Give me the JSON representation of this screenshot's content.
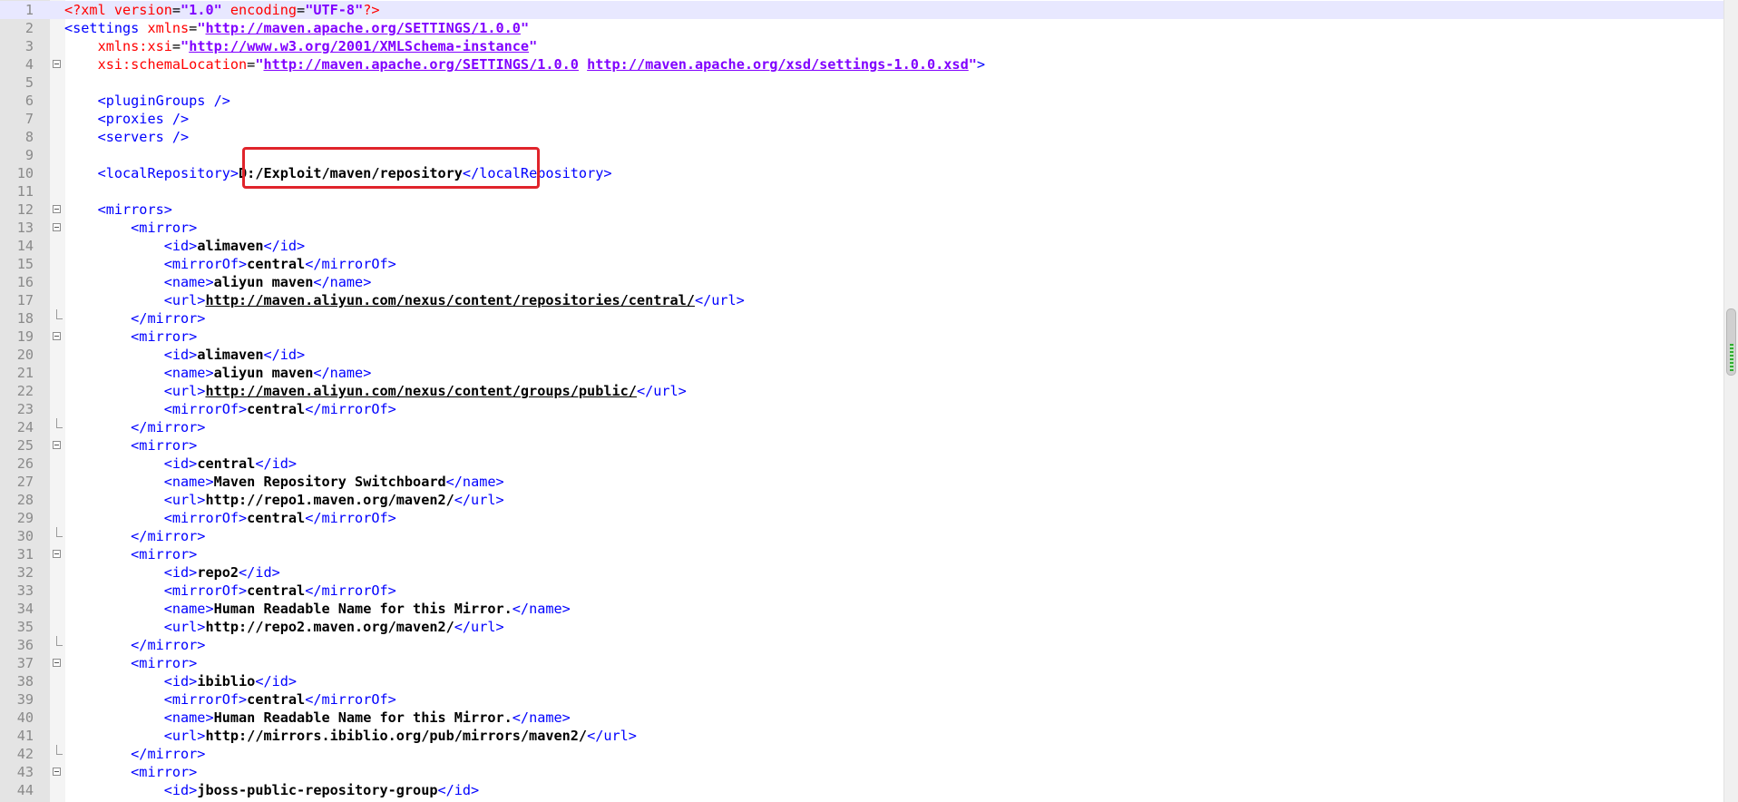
{
  "editor": {
    "current_line": 1,
    "highlight_line": 10,
    "scrollbar_position": 0.42,
    "colors": {
      "tag": "#0000ff",
      "attribute": "#ff0000",
      "attribute_value": "#8000ff",
      "text": "#000000",
      "highlight_box": "#e0242b"
    },
    "lines": [
      {
        "n": "1",
        "fold": "",
        "segs": [
          [
            "pi",
            "<?xml"
          ],
          [
            "a",
            " version"
          ],
          [
            "p",
            "="
          ],
          [
            "v",
            "\"1.0\""
          ],
          [
            "a",
            " encoding"
          ],
          [
            "p",
            "="
          ],
          [
            "v",
            "\"UTF-8\""
          ],
          [
            "pi",
            "?>"
          ]
        ]
      },
      {
        "n": "2",
        "fold": "",
        "segs": [
          [
            "t",
            "<settings"
          ],
          [
            "a",
            " xmlns"
          ],
          [
            "p",
            "="
          ],
          [
            "v",
            "\""
          ],
          [
            "u",
            "http://maven.apache.org/SETTINGS/1.0.0"
          ],
          [
            "v",
            "\""
          ]
        ]
      },
      {
        "n": "3",
        "fold": "",
        "segs": [
          [
            "p",
            "    "
          ],
          [
            "a",
            "xmlns:xsi"
          ],
          [
            "p",
            "="
          ],
          [
            "v",
            "\""
          ],
          [
            "u",
            "http://www.w3.org/2001/XMLSchema-instance"
          ],
          [
            "v",
            "\""
          ]
        ]
      },
      {
        "n": "4",
        "fold": "open",
        "segs": [
          [
            "p",
            "    "
          ],
          [
            "a",
            "xsi:schemaLocation"
          ],
          [
            "p",
            "="
          ],
          [
            "v",
            "\""
          ],
          [
            "u",
            "http://maven.apache.org/SETTINGS/1.0.0"
          ],
          [
            "v",
            " "
          ],
          [
            "u",
            "http://maven.apache.org/xsd/settings-1.0.0.xsd"
          ],
          [
            "v",
            "\""
          ],
          [
            "t",
            ">"
          ]
        ]
      },
      {
        "n": "5",
        "fold": "",
        "segs": []
      },
      {
        "n": "6",
        "fold": "",
        "segs": [
          [
            "p",
            "    "
          ],
          [
            "t",
            "<pluginGroups />"
          ]
        ]
      },
      {
        "n": "7",
        "fold": "",
        "segs": [
          [
            "p",
            "    "
          ],
          [
            "t",
            "<proxies />"
          ]
        ]
      },
      {
        "n": "8",
        "fold": "",
        "segs": [
          [
            "p",
            "    "
          ],
          [
            "t",
            "<servers />"
          ]
        ]
      },
      {
        "n": "9",
        "fold": "",
        "segs": []
      },
      {
        "n": "10",
        "fold": "",
        "segs": [
          [
            "p",
            "    "
          ],
          [
            "t",
            "<localRepository>"
          ],
          [
            "x",
            "D:/Exploit/maven/repository"
          ],
          [
            "t",
            "</localRepository>"
          ]
        ]
      },
      {
        "n": "11",
        "fold": "",
        "segs": []
      },
      {
        "n": "12",
        "fold": "open",
        "segs": [
          [
            "p",
            "    "
          ],
          [
            "t",
            "<mirrors>"
          ]
        ]
      },
      {
        "n": "13",
        "fold": "open",
        "segs": [
          [
            "p",
            "        "
          ],
          [
            "t",
            "<mirror>"
          ]
        ]
      },
      {
        "n": "14",
        "fold": "",
        "segs": [
          [
            "p",
            "            "
          ],
          [
            "t",
            "<id>"
          ],
          [
            "x",
            "alimaven"
          ],
          [
            "t",
            "</id>"
          ]
        ]
      },
      {
        "n": "15",
        "fold": "",
        "segs": [
          [
            "p",
            "            "
          ],
          [
            "t",
            "<mirrorOf>"
          ],
          [
            "x",
            "central"
          ],
          [
            "t",
            "</mirrorOf>"
          ]
        ]
      },
      {
        "n": "16",
        "fold": "",
        "segs": [
          [
            "p",
            "            "
          ],
          [
            "t",
            "<name>"
          ],
          [
            "x",
            "aliyun maven"
          ],
          [
            "t",
            "</name>"
          ]
        ]
      },
      {
        "n": "17",
        "fold": "",
        "segs": [
          [
            "p",
            "            "
          ],
          [
            "t",
            "<url>"
          ],
          [
            "xu",
            "http://maven.aliyun.com/nexus/content/repositories/central/"
          ],
          [
            "t",
            "</url>"
          ]
        ]
      },
      {
        "n": "18",
        "fold": "end",
        "segs": [
          [
            "p",
            "        "
          ],
          [
            "t",
            "</mirror>"
          ]
        ]
      },
      {
        "n": "19",
        "fold": "open",
        "segs": [
          [
            "p",
            "        "
          ],
          [
            "t",
            "<mirror>"
          ]
        ]
      },
      {
        "n": "20",
        "fold": "",
        "segs": [
          [
            "p",
            "            "
          ],
          [
            "t",
            "<id>"
          ],
          [
            "x",
            "alimaven"
          ],
          [
            "t",
            "</id>"
          ]
        ]
      },
      {
        "n": "21",
        "fold": "",
        "segs": [
          [
            "p",
            "            "
          ],
          [
            "t",
            "<name>"
          ],
          [
            "x",
            "aliyun maven"
          ],
          [
            "t",
            "</name>"
          ]
        ]
      },
      {
        "n": "22",
        "fold": "",
        "segs": [
          [
            "p",
            "            "
          ],
          [
            "t",
            "<url>"
          ],
          [
            "xu",
            "http://maven.aliyun.com/nexus/content/groups/public/"
          ],
          [
            "t",
            "</url>"
          ]
        ]
      },
      {
        "n": "23",
        "fold": "",
        "segs": [
          [
            "p",
            "            "
          ],
          [
            "t",
            "<mirrorOf>"
          ],
          [
            "x",
            "central"
          ],
          [
            "t",
            "</mirrorOf>"
          ]
        ]
      },
      {
        "n": "24",
        "fold": "end",
        "segs": [
          [
            "p",
            "        "
          ],
          [
            "t",
            "</mirror>"
          ]
        ]
      },
      {
        "n": "25",
        "fold": "open",
        "segs": [
          [
            "p",
            "        "
          ],
          [
            "t",
            "<mirror>"
          ]
        ]
      },
      {
        "n": "26",
        "fold": "",
        "segs": [
          [
            "p",
            "            "
          ],
          [
            "t",
            "<id>"
          ],
          [
            "x",
            "central"
          ],
          [
            "t",
            "</id>"
          ]
        ]
      },
      {
        "n": "27",
        "fold": "",
        "segs": [
          [
            "p",
            "            "
          ],
          [
            "t",
            "<name>"
          ],
          [
            "x",
            "Maven Repository Switchboard"
          ],
          [
            "t",
            "</name>"
          ]
        ]
      },
      {
        "n": "28",
        "fold": "",
        "segs": [
          [
            "p",
            "            "
          ],
          [
            "t",
            "<url>"
          ],
          [
            "x",
            "http://repo1.maven.org/maven2/"
          ],
          [
            "t",
            "</url>"
          ]
        ]
      },
      {
        "n": "29",
        "fold": "",
        "segs": [
          [
            "p",
            "            "
          ],
          [
            "t",
            "<mirrorOf>"
          ],
          [
            "x",
            "central"
          ],
          [
            "t",
            "</mirrorOf>"
          ]
        ]
      },
      {
        "n": "30",
        "fold": "end",
        "segs": [
          [
            "p",
            "        "
          ],
          [
            "t",
            "</mirror>"
          ]
        ]
      },
      {
        "n": "31",
        "fold": "open",
        "segs": [
          [
            "p",
            "        "
          ],
          [
            "t",
            "<mirror>"
          ]
        ]
      },
      {
        "n": "32",
        "fold": "",
        "segs": [
          [
            "p",
            "            "
          ],
          [
            "t",
            "<id>"
          ],
          [
            "x",
            "repo2"
          ],
          [
            "t",
            "</id>"
          ]
        ]
      },
      {
        "n": "33",
        "fold": "",
        "segs": [
          [
            "p",
            "            "
          ],
          [
            "t",
            "<mirrorOf>"
          ],
          [
            "x",
            "central"
          ],
          [
            "t",
            "</mirrorOf>"
          ]
        ]
      },
      {
        "n": "34",
        "fold": "",
        "segs": [
          [
            "p",
            "            "
          ],
          [
            "t",
            "<name>"
          ],
          [
            "x",
            "Human Readable Name for this Mirror."
          ],
          [
            "t",
            "</name>"
          ]
        ]
      },
      {
        "n": "35",
        "fold": "",
        "segs": [
          [
            "p",
            "            "
          ],
          [
            "t",
            "<url>"
          ],
          [
            "x",
            "http://repo2.maven.org/maven2/"
          ],
          [
            "t",
            "</url>"
          ]
        ]
      },
      {
        "n": "36",
        "fold": "end",
        "segs": [
          [
            "p",
            "        "
          ],
          [
            "t",
            "</mirror>"
          ]
        ]
      },
      {
        "n": "37",
        "fold": "open",
        "segs": [
          [
            "p",
            "        "
          ],
          [
            "t",
            "<mirror>"
          ]
        ]
      },
      {
        "n": "38",
        "fold": "",
        "segs": [
          [
            "p",
            "            "
          ],
          [
            "t",
            "<id>"
          ],
          [
            "x",
            "ibiblio"
          ],
          [
            "t",
            "</id>"
          ]
        ]
      },
      {
        "n": "39",
        "fold": "",
        "segs": [
          [
            "p",
            "            "
          ],
          [
            "t",
            "<mirrorOf>"
          ],
          [
            "x",
            "central"
          ],
          [
            "t",
            "</mirrorOf>"
          ]
        ]
      },
      {
        "n": "40",
        "fold": "",
        "segs": [
          [
            "p",
            "            "
          ],
          [
            "t",
            "<name>"
          ],
          [
            "x",
            "Human Readable Name for this Mirror."
          ],
          [
            "t",
            "</name>"
          ]
        ]
      },
      {
        "n": "41",
        "fold": "",
        "segs": [
          [
            "p",
            "            "
          ],
          [
            "t",
            "<url>"
          ],
          [
            "x",
            "http://mirrors.ibiblio.org/pub/mirrors/maven2/"
          ],
          [
            "t",
            "</url>"
          ]
        ]
      },
      {
        "n": "42",
        "fold": "end",
        "segs": [
          [
            "p",
            "        "
          ],
          [
            "t",
            "</mirror>"
          ]
        ]
      },
      {
        "n": "43",
        "fold": "open",
        "segs": [
          [
            "p",
            "        "
          ],
          [
            "t",
            "<mirror>"
          ]
        ]
      },
      {
        "n": "44",
        "fold": "",
        "segs": [
          [
            "p",
            "            "
          ],
          [
            "t",
            "<id>"
          ],
          [
            "x",
            "jboss-public-repository-group"
          ],
          [
            "t",
            "</id>"
          ]
        ]
      }
    ]
  }
}
